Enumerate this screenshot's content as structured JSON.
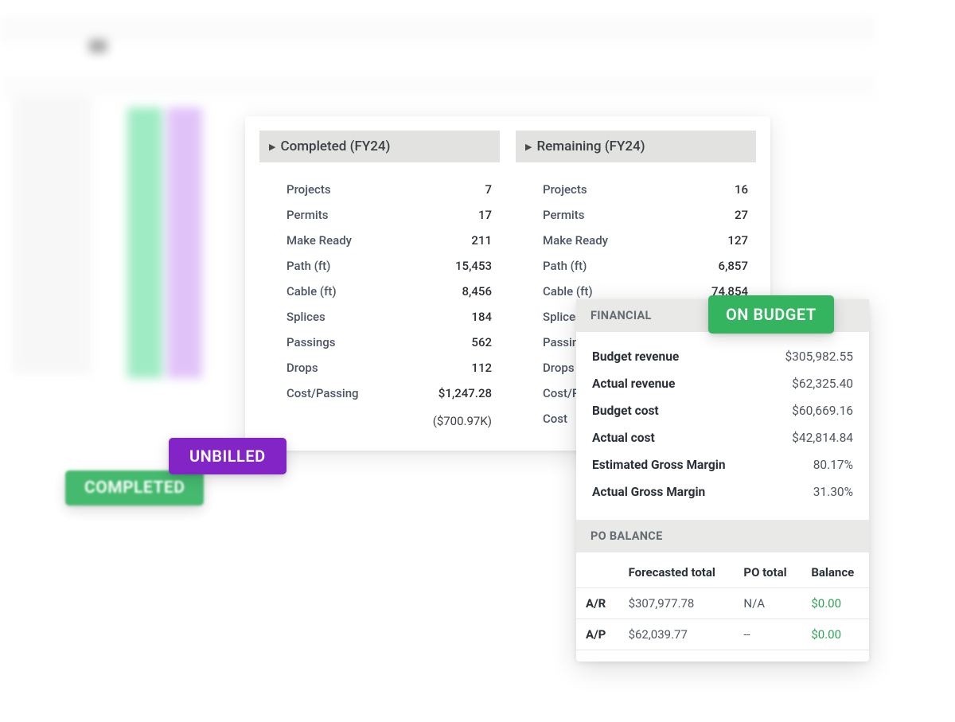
{
  "badges": {
    "completed": "COMPLETED",
    "unbilled": "UNBILLED",
    "on_budget": "ON BUDGET"
  },
  "panels": {
    "completed": {
      "title": "Completed (FY24)",
      "metrics": [
        {
          "label": "Projects",
          "value": "7"
        },
        {
          "label": "Permits",
          "value": "17"
        },
        {
          "label": "Make Ready",
          "value": "211"
        },
        {
          "label": "Path (ft)",
          "value": "15,453"
        },
        {
          "label": "Cable (ft)",
          "value": "8,456"
        },
        {
          "label": "Splices",
          "value": "184"
        },
        {
          "label": "Passings",
          "value": "562"
        },
        {
          "label": "Drops",
          "value": "112"
        },
        {
          "label": "Cost/Passing",
          "value": "$1,247.28"
        }
      ],
      "total": "($700.97K)"
    },
    "remaining": {
      "title": "Remaining (FY24)",
      "metrics": [
        {
          "label": "Projects",
          "value": "16"
        },
        {
          "label": "Permits",
          "value": "27"
        },
        {
          "label": "Make Ready",
          "value": "127"
        },
        {
          "label": "Path (ft)",
          "value": "6,857"
        },
        {
          "label": "Cable (ft)",
          "value": "74,854"
        },
        {
          "label": "Splices",
          "value": ""
        },
        {
          "label": "Passings",
          "value": ""
        },
        {
          "label": "Drops",
          "value": ""
        },
        {
          "label": "Cost/Pas",
          "value": ""
        }
      ],
      "total_label": "Cost"
    }
  },
  "financial": {
    "header": "FINANCIAL",
    "rows": [
      {
        "label": "Budget revenue",
        "value": "$305,982.55"
      },
      {
        "label": "Actual revenue",
        "value": "$62,325.40"
      },
      {
        "label": "Budget cost",
        "value": "$60,669.16"
      },
      {
        "label": "Actual cost",
        "value": "$42,814.84"
      },
      {
        "label": "Estimated Gross Margin",
        "value": "80.17%"
      },
      {
        "label": "Actual Gross Margin",
        "value": "31.30%"
      }
    ]
  },
  "po_balance": {
    "header": "PO BALANCE",
    "columns": [
      "",
      "Forecasted total",
      "PO total",
      "Balance"
    ],
    "rows": [
      {
        "head": "A/R",
        "forecasted": "$307,977.78",
        "po": "N/A",
        "balance": "$0.00"
      },
      {
        "head": "A/P",
        "forecasted": "$62,039.77",
        "po": "--",
        "balance": "$0.00"
      }
    ]
  }
}
